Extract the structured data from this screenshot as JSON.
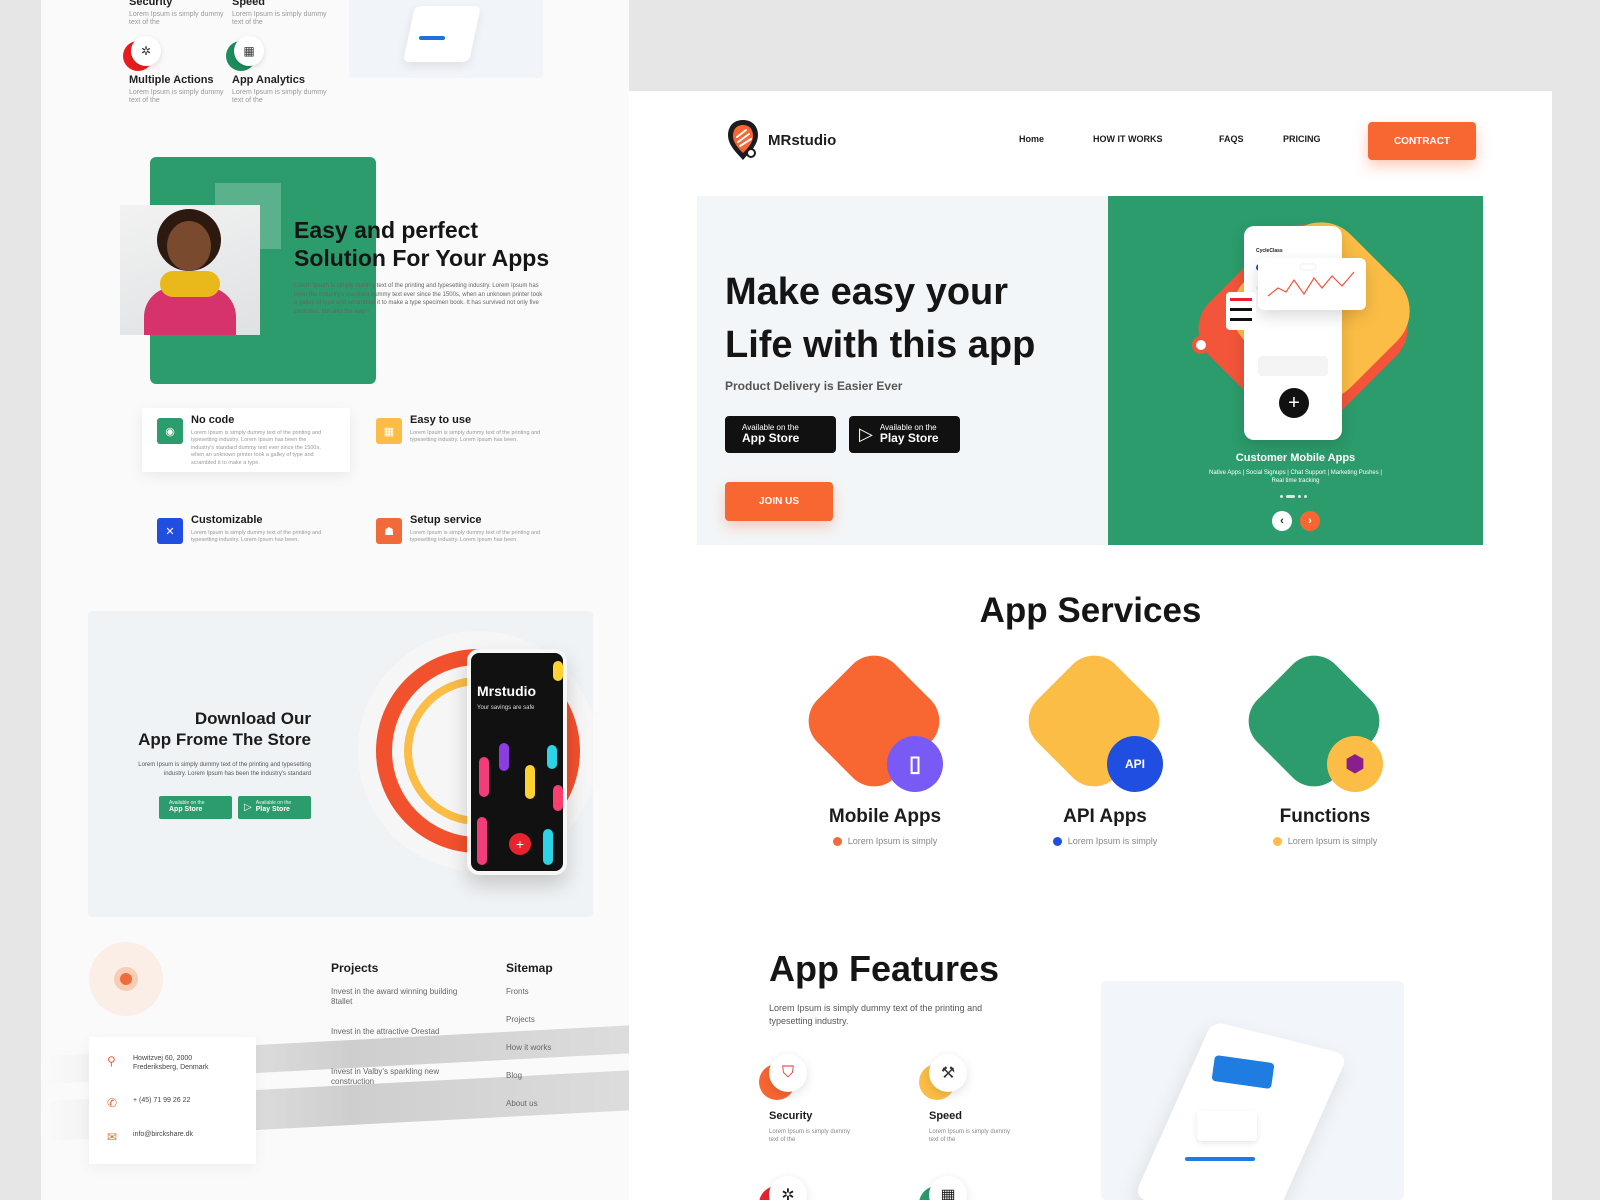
{
  "left_top": {
    "items": [
      {
        "title": "Security",
        "desc": "Lorem Ipsum is simply dummy text of the"
      },
      {
        "title": "Speed",
        "desc": "Lorem Ipsum is simply dummy text of the"
      },
      {
        "title": "Multiple Actions",
        "desc": "Lorem Ipsum is simply dummy text of the"
      },
      {
        "title": "App Analytics",
        "desc": "Lorem Ipsum is simply dummy text of the"
      }
    ]
  },
  "solution": {
    "heading_line1": "Easy and perfect",
    "heading_line2": "Solution For Your Apps",
    "paragraph": "Lorem Ipsum is simply dummy text of the printing and typesetting industry. Lorem Ipsum has been the industry's standard dummy text ever since the 1500s, when an unknown printer took a galley of type and scrambled it to make a type specimen book. It has survived not only five centuries, but also the leap i"
  },
  "features": [
    {
      "title": "No code",
      "desc": "Lorem Ipsum is simply dummy text of the printing and typesetting industry. Lorem Ipsum has been the industry's standard dummy text ever since the 1500s, when an unknown printer took a galley of type and scrambled it to make a type.",
      "color": "#2c9c6c",
      "icon": "code-icon"
    },
    {
      "title": "Easy to use",
      "desc": "Lorem Ipsum is simply dummy text of the printing and typesetting industry. Lorem Ipsum has been.",
      "color": "#fbbd45",
      "icon": "grid-icon"
    },
    {
      "title": "Customizable",
      "desc": "Lorem Ipsum is simply dummy text of the printing and typesetting industry. Lorem Ipsum has been.",
      "color": "#1f4ee0",
      "icon": "tools-icon"
    },
    {
      "title": "Setup service",
      "desc": "Lorem Ipsum is simply dummy text of the printing and typesetting industry. Lorem Ipsum has been.",
      "color": "#f06a3a",
      "icon": "service-icon"
    }
  ],
  "download": {
    "title_line1": "Download Our",
    "title_line2": "App Frome The Store",
    "paragraph": "Lorem Ipsum is simply dummy text of the printing and typesetting industry. Lorem Ipsum has been the industry's standard",
    "appstore_small": "Available on the",
    "appstore_big": "App Store",
    "playstore_small": "Available on the",
    "playstore_big": "Play Store",
    "phone_title": "Mrstudio",
    "phone_sub": "Your savings are safe"
  },
  "footer": {
    "address": "Howitzvej 60, 2000 Frederiksberg, Denmark",
    "phone": "+ (45) 71 99 26 22",
    "email": "info@birckshare.dk",
    "projects_heading": "Projects",
    "projects": [
      "Invest in the award winning building 8tallet",
      "Invest in the attractive Orestad",
      "Invest in Valby's sparkling new construction"
    ],
    "sitemap_heading": "Sitemap",
    "sitemap": [
      "Fronts",
      "Projects",
      "How it works",
      "Blog",
      "About us"
    ]
  },
  "header": {
    "brand": "MRstudio",
    "nav": [
      "Home",
      "HOW IT WORKS",
      "FAQS",
      "PRICING"
    ],
    "cta": "CONTRACT"
  },
  "hero": {
    "title_line1": "Make easy your",
    "title_line2": "Life with this app",
    "subtitle": "Product Delivery is Easier Ever",
    "appstore_small": "Available on the",
    "appstore_big": "App Store",
    "playstore_small": "Available on the",
    "playstore_big": "Play Store",
    "join": "JOIN US",
    "card_app_name": "CycleClass",
    "slide_title": "Customer Mobile Apps",
    "slide_sub": "Native Apps | Social Signups | Chat Support | Marketing Pushes | Real time tracking"
  },
  "services": {
    "title": "App Services",
    "items": [
      {
        "name": "Mobile Apps",
        "desc": "Lorem Ipsum is simply",
        "color": "#f86632",
        "dot": "#f06a3a",
        "badge": "#7a5af5"
      },
      {
        "name": "API Apps",
        "desc": "Lorem Ipsum is simply",
        "color": "#fbbd45",
        "dot": "#1f4ee0",
        "badge": "#1f4ee0"
      },
      {
        "name": "Functions",
        "desc": "Lorem Ipsum is simply",
        "color": "#2c9c6c",
        "dot": "#fbbd45",
        "badge": "#fbbd45"
      }
    ]
  },
  "app_features": {
    "title": "App Features",
    "paragraph": "Lorem Ipsum is simply dummy text of the printing and typesetting industry.",
    "items": [
      {
        "name": "Security",
        "desc": "Lorem Ipsum is simply dummy text of the"
      },
      {
        "name": "Speed",
        "desc": "Lorem Ipsum is simply dummy text of the"
      }
    ]
  },
  "colors": {
    "orange": "#f86632",
    "green": "#2c9c6c",
    "yellow": "#fbbd45",
    "blue": "#1f4ee0"
  }
}
